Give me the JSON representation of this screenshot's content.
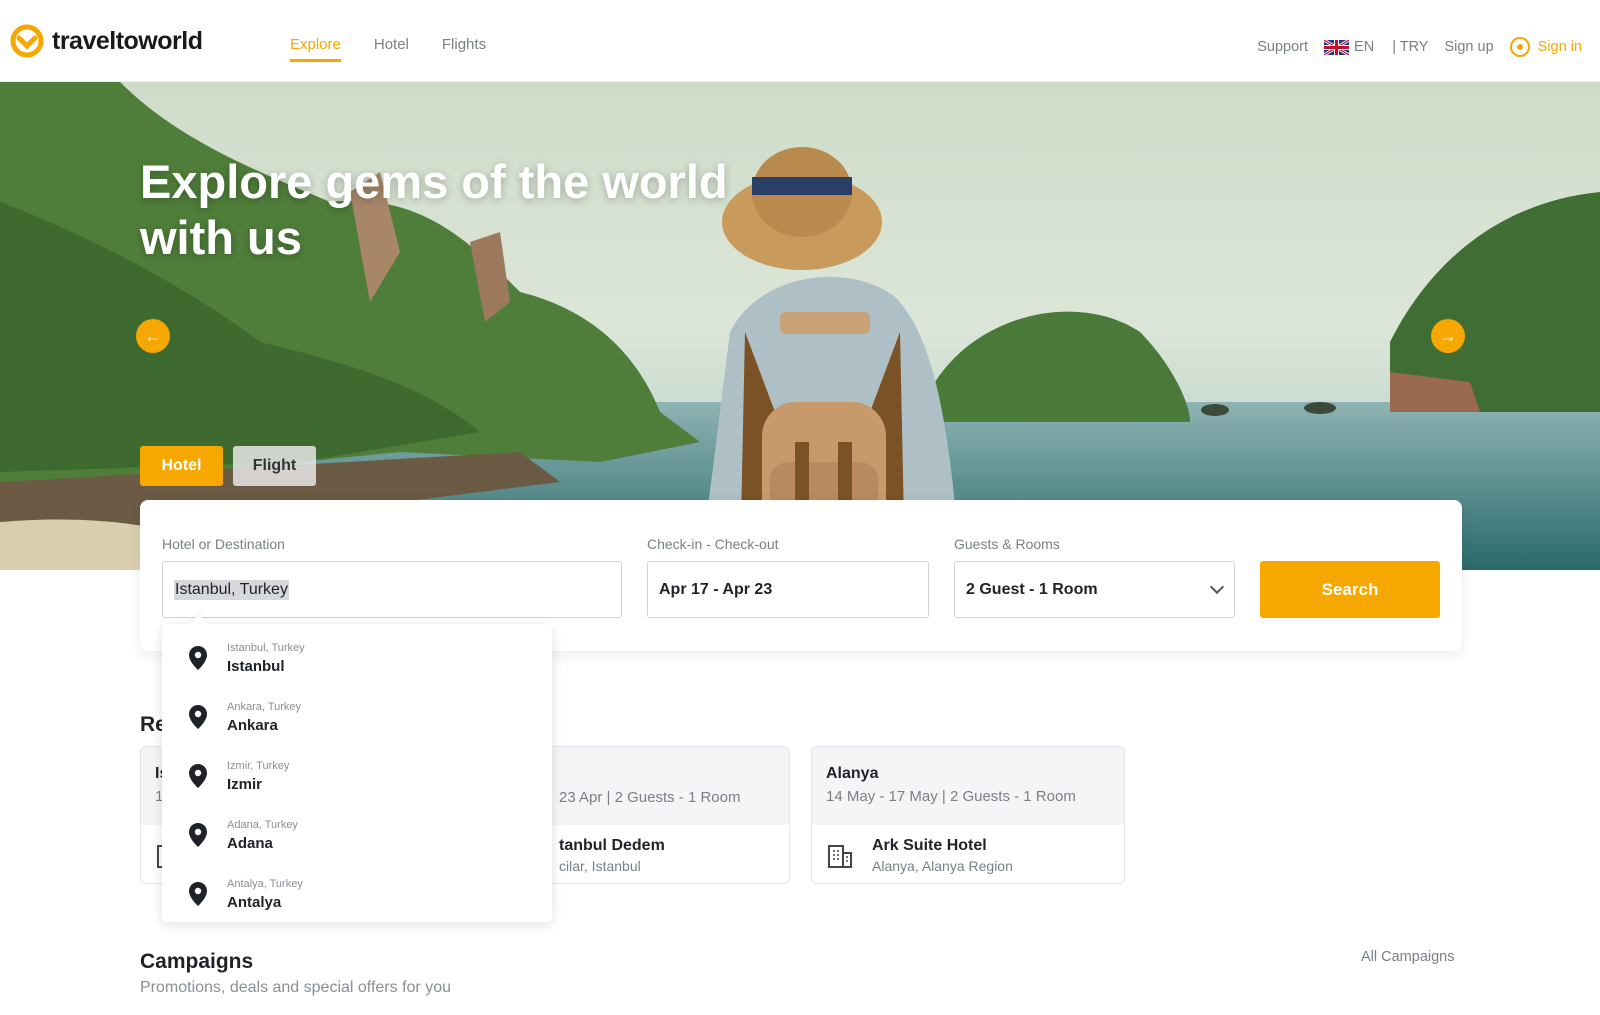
{
  "brand": {
    "name": "traveltoworld",
    "accent": "#f6a700"
  },
  "nav": {
    "items": [
      "Explore",
      "Hotel",
      "Flights"
    ],
    "active": "Explore"
  },
  "header_right": {
    "support": "Support",
    "language": "EN",
    "currency": "| TRY",
    "signup": "Sign up",
    "signin": "Sign in"
  },
  "hero": {
    "title_line1": "Explore gems of the world",
    "title_line2": "with us",
    "tabs": [
      "Hotel",
      "Flight"
    ]
  },
  "search": {
    "dest_label": "Hotel or Destination",
    "dest_value": "Istanbul, Turkey",
    "dates_label": "Check-in - Check-out",
    "dates_value": "Apr 17 - Apr 23",
    "guests_label": "Guests & Rooms",
    "guests_value": "2 Guest - 1 Room",
    "button": "Search"
  },
  "suggestions": [
    {
      "sub": "Istanbul, Turkey",
      "main": "Istanbul"
    },
    {
      "sub": "Ankara, Turkey",
      "main": "Ankara"
    },
    {
      "sub": "Izmir, Turkey",
      "main": "Izmir"
    },
    {
      "sub": "Adana, Turkey",
      "main": "Adana"
    },
    {
      "sub": "Antalya, Turkey",
      "main": "Antalya"
    }
  ],
  "recent": {
    "title_visible": "Re",
    "cards": [
      {
        "city": "Is",
        "meta": "1",
        "hotel": "",
        "location": ""
      },
      {
        "city": "",
        "meta": "23 Apr | 2 Guests - 1 Room",
        "hotel": "tanbul Dedem",
        "location": "cilar, Istanbul"
      },
      {
        "city": "Alanya",
        "meta": "14 May - 17 May | 2 Guests - 1 Room",
        "hotel": "Ark Suite Hotel",
        "location": "Alanya, Alanya Region"
      }
    ]
  },
  "campaigns": {
    "title": "Campaigns",
    "subtitle": "Promotions, deals and special offers for you",
    "all": "All Campaigns"
  },
  "icons": [
    "logo-icon",
    "uk-flag-icon",
    "user-icon",
    "arrow-left-icon",
    "arrow-right-icon",
    "chevron-down-icon",
    "location-pin-icon",
    "building-icon"
  ]
}
